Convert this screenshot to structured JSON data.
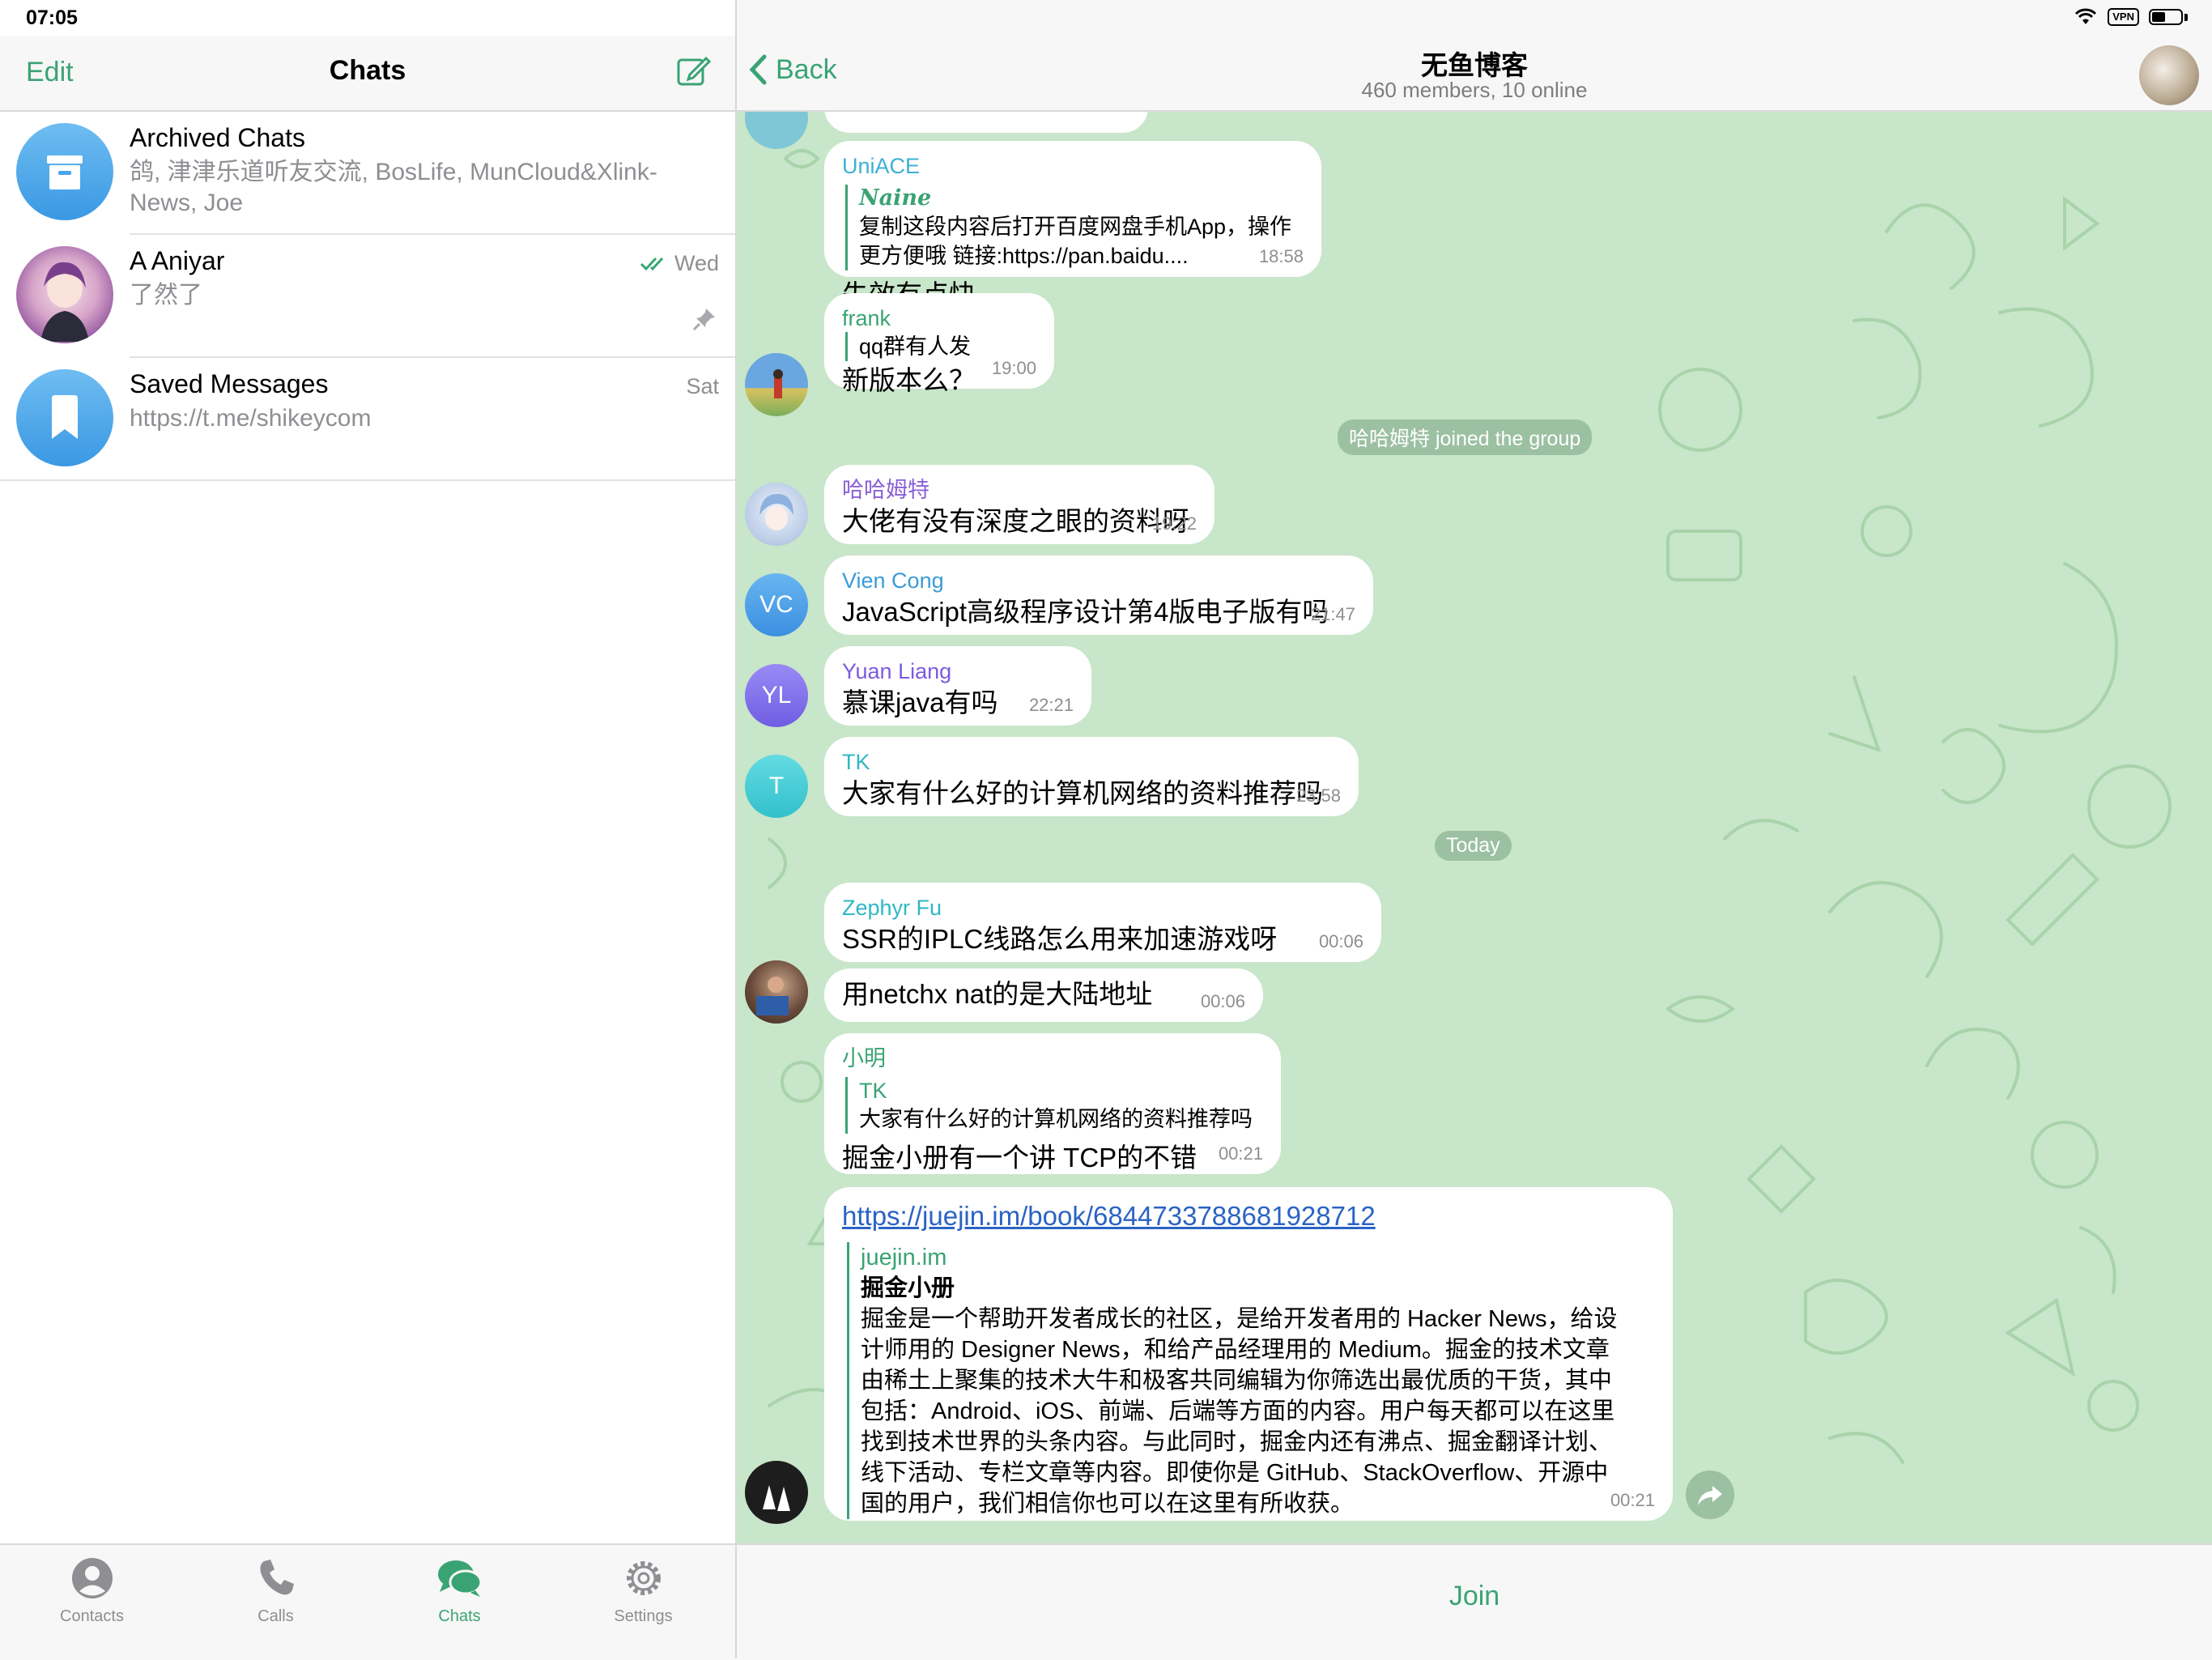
{
  "status_bar": {
    "time": "07:05",
    "vpn": "VPN"
  },
  "left_nav": {
    "edit": "Edit",
    "title": "Chats"
  },
  "chats": [
    {
      "name": "Archived Chats",
      "preview": "鸽, 津津乐道听友交流, BosLife, MunCloud&Xlink-News, Joe",
      "date": ""
    },
    {
      "name": "A Aniyar",
      "preview": "了然了",
      "date": "Wed",
      "read": true,
      "pinned": true
    },
    {
      "name": "Saved Messages",
      "preview": "https://t.me/shikeycom",
      "date": "Sat"
    }
  ],
  "tabs": [
    {
      "label": "Contacts",
      "icon": "person-icon"
    },
    {
      "label": "Calls",
      "icon": "phone-icon"
    },
    {
      "label": "Chats",
      "icon": "chat-bubbles-icon",
      "active": true
    },
    {
      "label": "Settings",
      "icon": "gear-icon"
    }
  ],
  "conversation": {
    "back": "Back",
    "title": "无鱼博客",
    "subtitle": "460 members, 10 online",
    "join": "Join",
    "messages": [
      {
        "sender": "UniACE",
        "reply_name": "Naine",
        "reply_text": "复制这段内容后打开百度网盘手机App，操作更方便哦 链接:https://pan.baidu....",
        "text": "失效有点快",
        "time": "18:58"
      },
      {
        "sender": "frank",
        "reply_text": "qq群有人发",
        "text": "新版本么？",
        "time": "19:00"
      },
      {
        "service": "哈哈姆特 joined the group"
      },
      {
        "sender": "哈哈姆特",
        "text": "大佬有没有深度之眼的资料呀",
        "time": "19:22"
      },
      {
        "sender": "Vien Cong",
        "initials": "VC",
        "text": "JavaScript高级程序设计第4版电子版有吗",
        "time": "21:47"
      },
      {
        "sender": "Yuan Liang",
        "initials": "YL",
        "text": "慕课java有吗",
        "time": "22:21"
      },
      {
        "sender": "TK",
        "initials": "T",
        "text": "大家有什么好的计算机网络的资料推荐吗",
        "time": "23:58"
      },
      {
        "service": "Today"
      },
      {
        "sender": "Zephyr Fu",
        "text": "SSR的IPLC线路怎么用来加速游戏呀",
        "time": "00:06"
      },
      {
        "text": "用netchx nat的是大陆地址",
        "time": "00:06"
      },
      {
        "sender": "小明",
        "reply_name": "TK",
        "reply_text": "大家有什么好的计算机网络的资料推荐吗",
        "text": "掘金小册有一个讲 TCP的不错",
        "time": "00:21"
      },
      {
        "link": "https://juejin.im/book/6844733788681928712",
        "site": "juejin.im",
        "link_title": "掘金小册",
        "description": [
          "掘金是一个帮助开发者成长的社区，是给开发者用的 Hacker News，给设",
          "计师用的 Designer News，和给产品经理用的 Medium。掘金的技术文章",
          "由稀土上聚集的技术大牛和极客共同编辑为你筛选出最优质的干货，其中",
          "包括：Android、iOS、前端、后端等方面的内容。用户每天都可以在这里",
          "找到技术世界的头条内容。与此同时，掘金内还有沸点、掘金翻译计划、",
          "线下活动、专栏文章等内容。即使你是 GitHub、StackOverflow、开源中",
          "国的用户，我们相信你也可以在这里有所收获。"
        ],
        "time": "00:21"
      }
    ]
  },
  "colors": {
    "accent": "#3aa374",
    "chat_background": "#c8e6c9",
    "sender_uniace": "#3bb0d6",
    "sender_frank": "#3aa374",
    "sender_hahamute": "#8a5fd6",
    "sender_vien": "#3b9bd6",
    "sender_yuan": "#7b5be0",
    "sender_tk": "#2fb8c4",
    "sender_zephyr": "#2fb8c4",
    "sender_xiaoming": "#3aa374"
  }
}
